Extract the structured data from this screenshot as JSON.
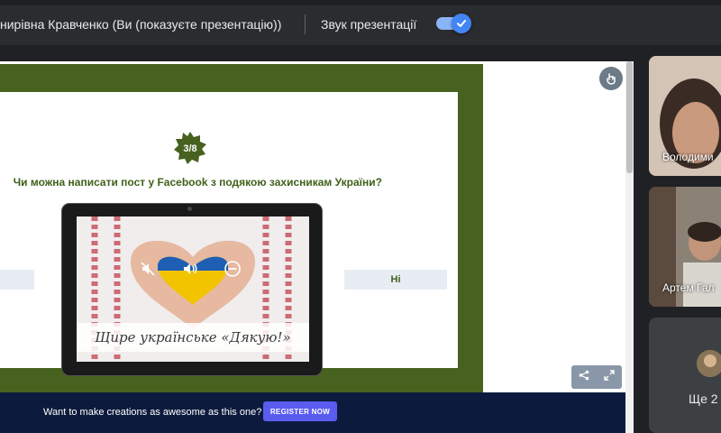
{
  "topbar": {
    "presenter_label": "нирівна Кравченко (Ви (показуєте презентацію))",
    "sound_label": "Звук презентації",
    "sound_enabled": true
  },
  "slide": {
    "counter": "3/8",
    "question": "Чи можна написати пост у Facebook з подякою захисникам України?",
    "answer_right": "Ні",
    "image_caption": "Щире українське «Дякую!»"
  },
  "promo": {
    "text": "Want to make creations as awesome as this one?",
    "button_label": "REGISTER NOW"
  },
  "participants": [
    {
      "name": "Володими"
    },
    {
      "name": "Артем Гал"
    }
  ],
  "more_participants": "Ще 2",
  "colors": {
    "accent": "#46621e",
    "promo_bg": "#0c1b3d",
    "register": "#5a5cf0",
    "toggle": "#4285f4"
  },
  "icons": [
    "check-icon",
    "pointer-icon",
    "share-icon",
    "fullscreen-icon",
    "mute-icon",
    "volume-icon",
    "minus-icon"
  ]
}
